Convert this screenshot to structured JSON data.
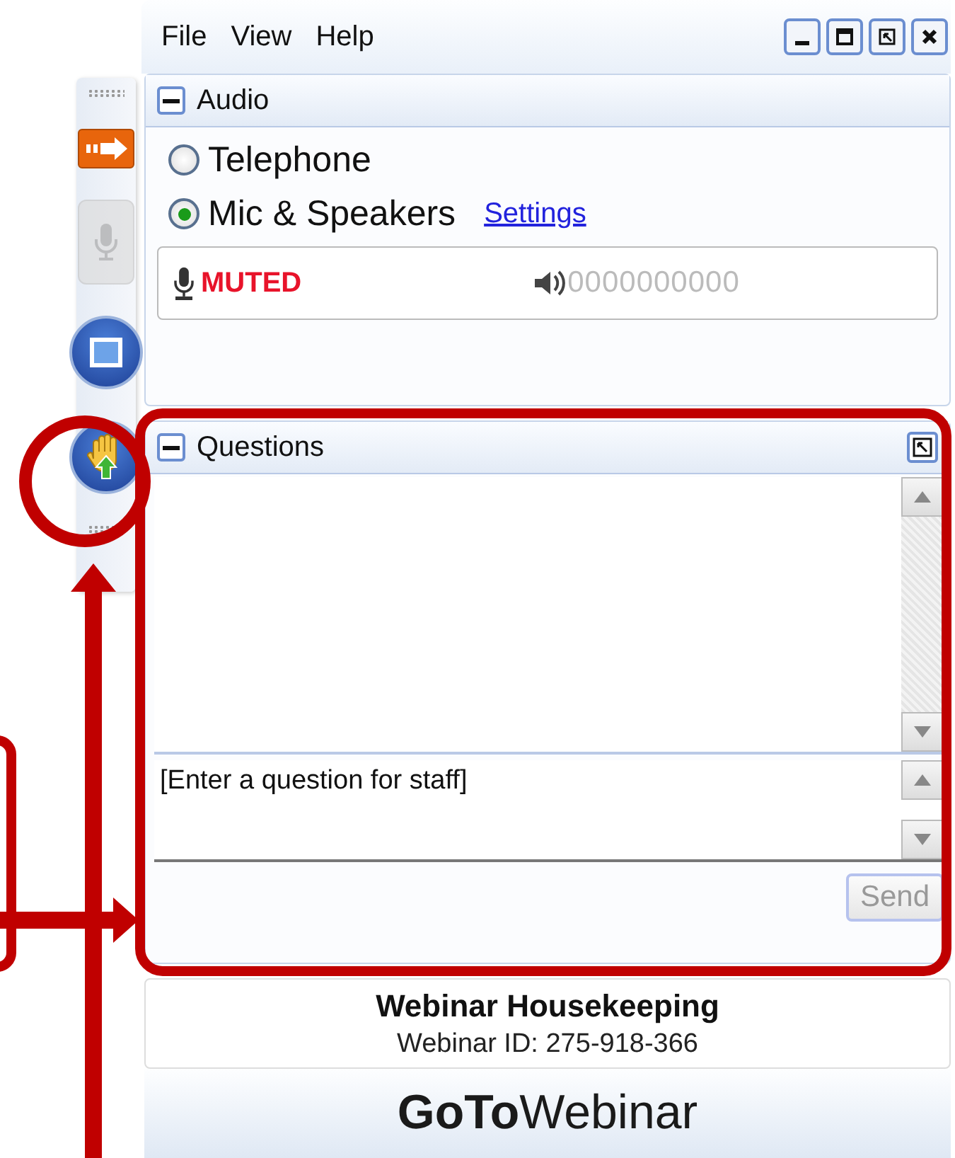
{
  "menu": [
    "File",
    "View",
    "Help"
  ],
  "toolbar": [
    {
      "kind": "arrow",
      "disabled": false
    },
    {
      "kind": "mic",
      "disabled": true
    },
    {
      "kind": "screen",
      "disabled": false
    },
    {
      "kind": "hand",
      "disabled": false
    }
  ],
  "audio": {
    "title": "Audio",
    "options": [
      {
        "label": "Telephone",
        "selected": false
      },
      {
        "label": "Mic & Speakers",
        "selected": true
      }
    ],
    "settings_link": "Settings",
    "mic_status": "MUTED",
    "speaker_meter": "0000000000"
  },
  "questions": {
    "title": "Questions",
    "placeholder": "[Enter a question for staff]",
    "send": "Send",
    "send_disabled": true
  },
  "webinar": {
    "title": "Webinar Housekeeping",
    "id_line": "Webinar ID: 275-918-366"
  },
  "logo": "**GoTo**Webinar"
}
